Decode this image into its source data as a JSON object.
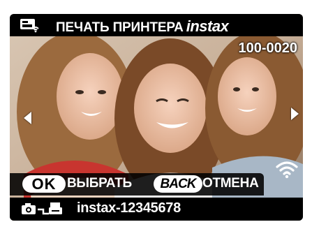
{
  "header": {
    "title": "ПЕЧАТЬ ПРИНТЕРА",
    "brand": "instax",
    "icon": "printer-wifi-icon"
  },
  "image": {
    "frame_number": "100-0020",
    "prev_icon": "arrow-left-icon",
    "next_icon": "arrow-right-icon",
    "wifi_icon": "wifi-icon"
  },
  "controls": {
    "ok_key": "OK",
    "ok_action": "ВЫБРАТЬ",
    "back_key": "BACK",
    "back_action": "ОТМЕНА"
  },
  "status": {
    "connection_icon": "camera-to-printer-icon",
    "device_name": "instax-12345678"
  },
  "colors": {
    "bar_background": "#000000",
    "text": "#ffffff",
    "pill_background": "#ffffff"
  }
}
